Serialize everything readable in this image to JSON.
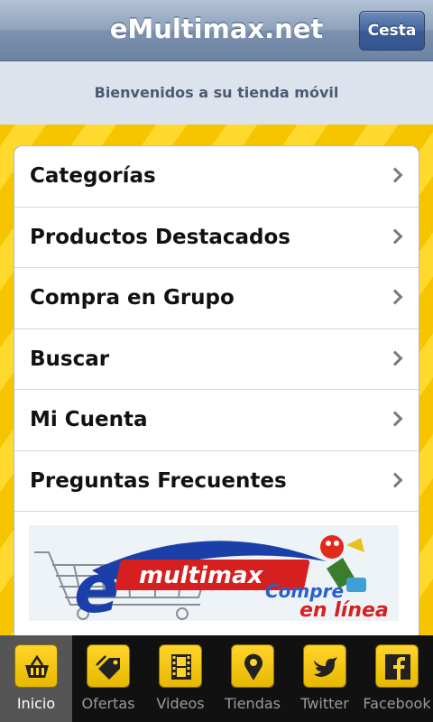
{
  "header": {
    "title": "eMultimax.net",
    "cart_label": "Cesta"
  },
  "welcome": {
    "text": "Bienvenidos a su tienda móvil"
  },
  "menu": {
    "items": [
      {
        "label": "Categorías"
      },
      {
        "label": "Productos Destacados"
      },
      {
        "label": "Compra en Grupo"
      },
      {
        "label": "Buscar"
      },
      {
        "label": "Mi Cuenta"
      },
      {
        "label": "Preguntas Frecuentes"
      }
    ]
  },
  "banner": {
    "logo_text": "emultimax",
    "tagline_1": "Compre",
    "tagline_2": "en línea"
  },
  "tabbar": {
    "tabs": [
      {
        "label": "Inicio",
        "icon": "basket-icon",
        "active": true
      },
      {
        "label": "Ofertas",
        "icon": "tag-icon",
        "active": false
      },
      {
        "label": "Videos",
        "icon": "film-icon",
        "active": false
      },
      {
        "label": "Tiendas",
        "icon": "map-pin-icon",
        "active": false
      },
      {
        "label": "Twitter",
        "icon": "twitter-bird-icon",
        "active": false
      },
      {
        "label": "Facebook",
        "icon": "facebook-icon",
        "active": false
      }
    ]
  },
  "colors": {
    "background_yellow": "#f6c200",
    "header_blue": "#8ea2bd",
    "cart_button_blue": "#4466a0",
    "tabbar_black": "#111111",
    "logo_blue": "#1a3fa8",
    "logo_red": "#d62020"
  }
}
